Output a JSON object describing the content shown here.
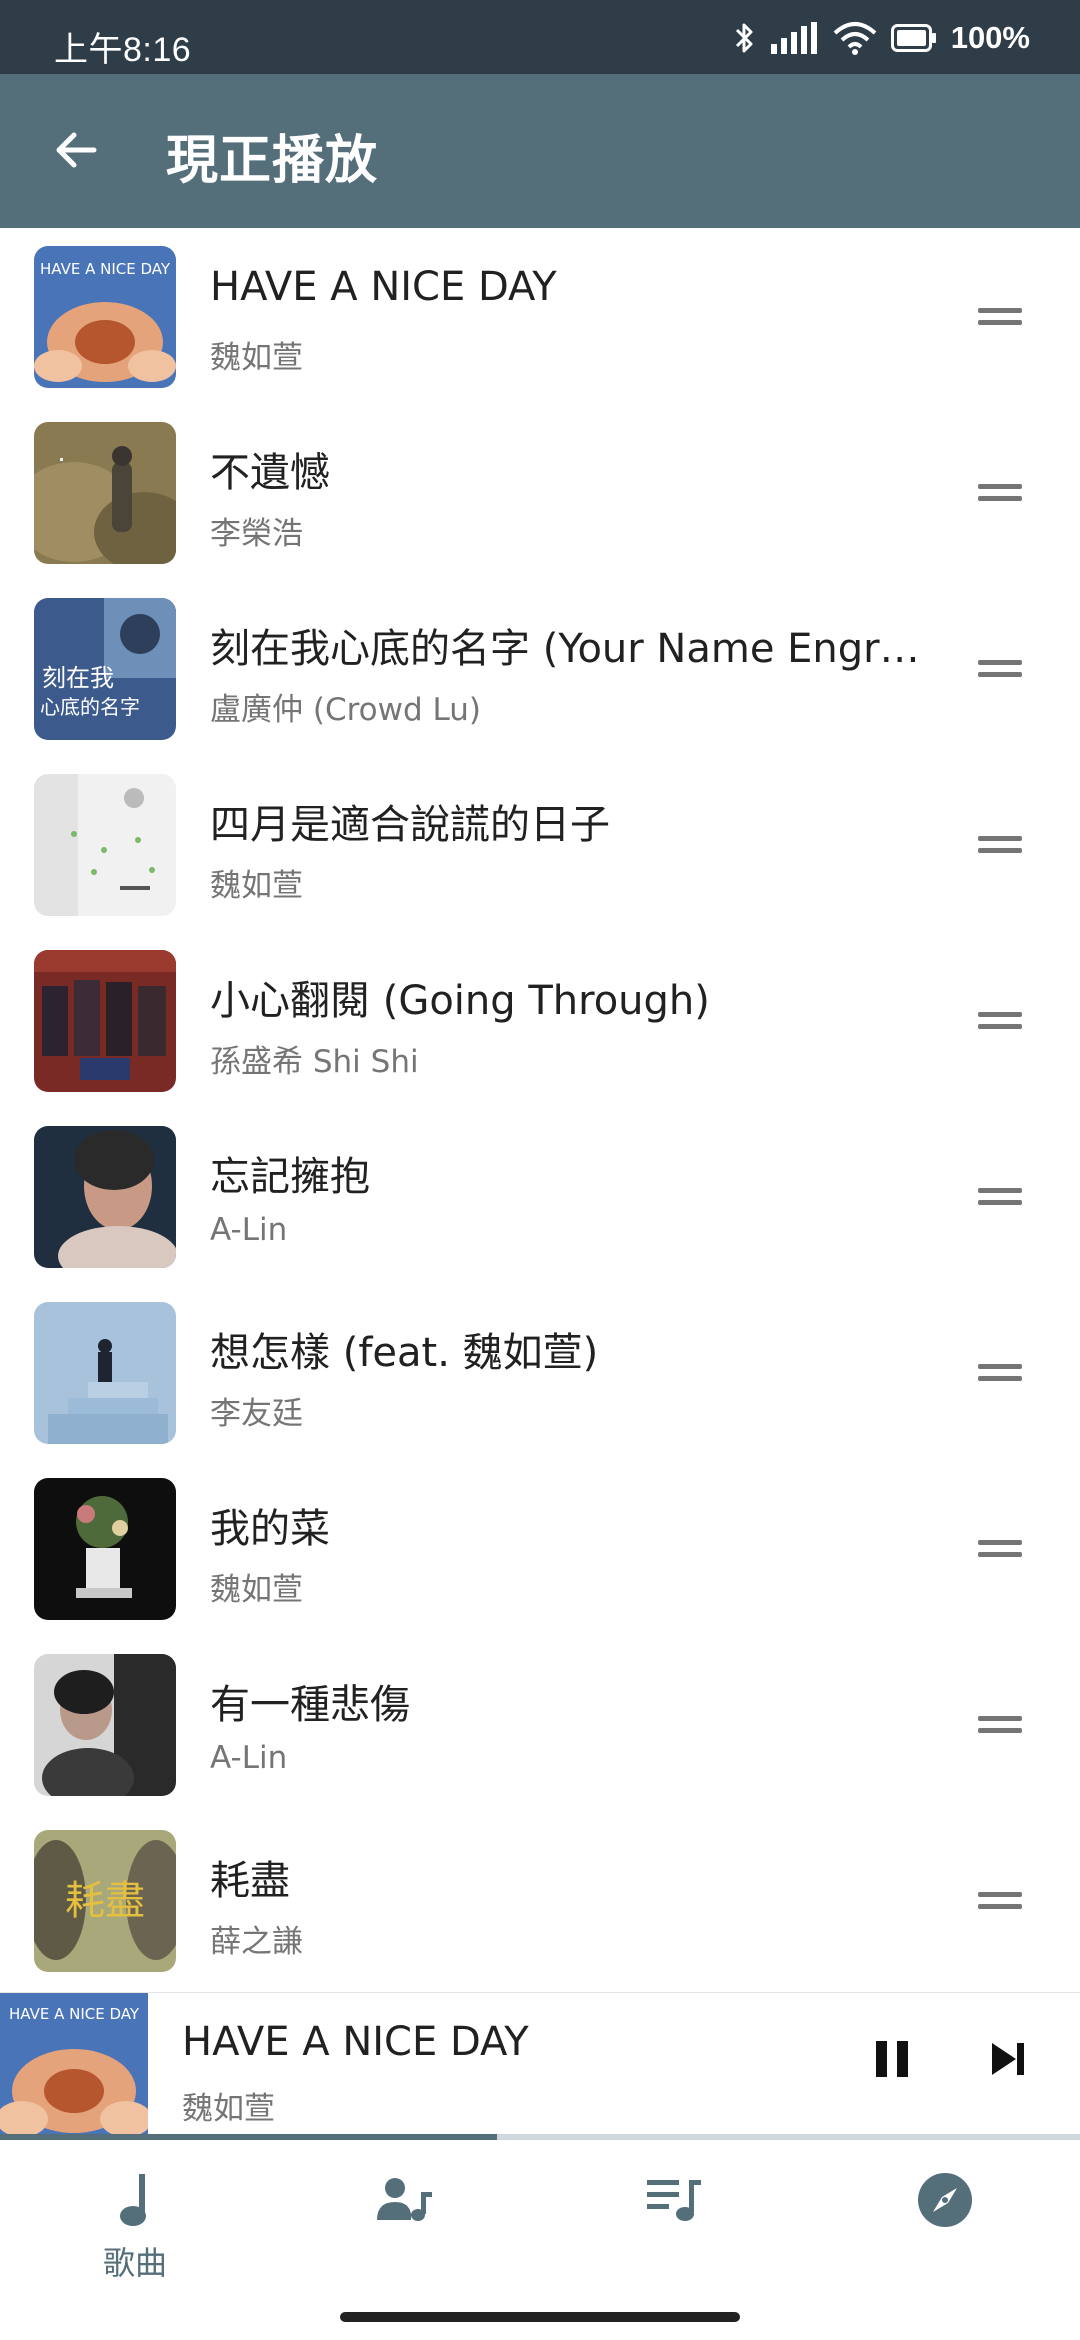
{
  "status_bar": {
    "time": "上午8:16",
    "battery": "100%",
    "icons": [
      "bluetooth-icon",
      "signal-icon",
      "wifi-icon",
      "battery-icon"
    ]
  },
  "app_bar": {
    "title": "現正播放",
    "back_icon": "arrow-left-icon"
  },
  "colors": {
    "status_bar": "#2e3d48",
    "app_bar": "#546e7a",
    "accent": "#546e7a"
  },
  "songs": [
    {
      "title": "HAVE A NICE DAY",
      "artist": "魏如萱"
    },
    {
      "title": "不遺憾",
      "artist": "李榮浩"
    },
    {
      "title": "刻在我心底的名字 (Your Name Engraved Herein)",
      "artist": "盧廣仲 (Crowd Lu)"
    },
    {
      "title": "四月是適合說謊的日子",
      "artist": "魏如萱"
    },
    {
      "title": "小心翻閱 (Going Through)",
      "artist": "孫盛希 Shi Shi"
    },
    {
      "title": "忘記擁抱",
      "artist": "A-Lin"
    },
    {
      "title": "想怎樣 (feat. 魏如萱)",
      "artist": "李友廷"
    },
    {
      "title": "我的菜",
      "artist": "魏如萱"
    },
    {
      "title": "有一種悲傷",
      "artist": "A-Lin"
    },
    {
      "title": "耗盡",
      "artist": "薛之謙"
    }
  ],
  "cover_art_text": {
    "have_a_nice_day": "HAVE A NICE DAY",
    "song3_cover": "刻在我心底的名字",
    "song10_cover": "耗盡"
  },
  "mini_player": {
    "title": "HAVE A NICE DAY",
    "artist": "魏如萱",
    "progress": 0.46,
    "pause_icon": "pause-icon",
    "next_icon": "skip-next-icon"
  },
  "bottom_nav": {
    "items": [
      {
        "label": "歌曲",
        "icon": "music-note-icon",
        "active": true
      },
      {
        "label": "",
        "icon": "artist-icon",
        "active": false
      },
      {
        "label": "",
        "icon": "playlist-icon",
        "active": false
      },
      {
        "label": "",
        "icon": "compass-icon",
        "active": false
      }
    ]
  }
}
